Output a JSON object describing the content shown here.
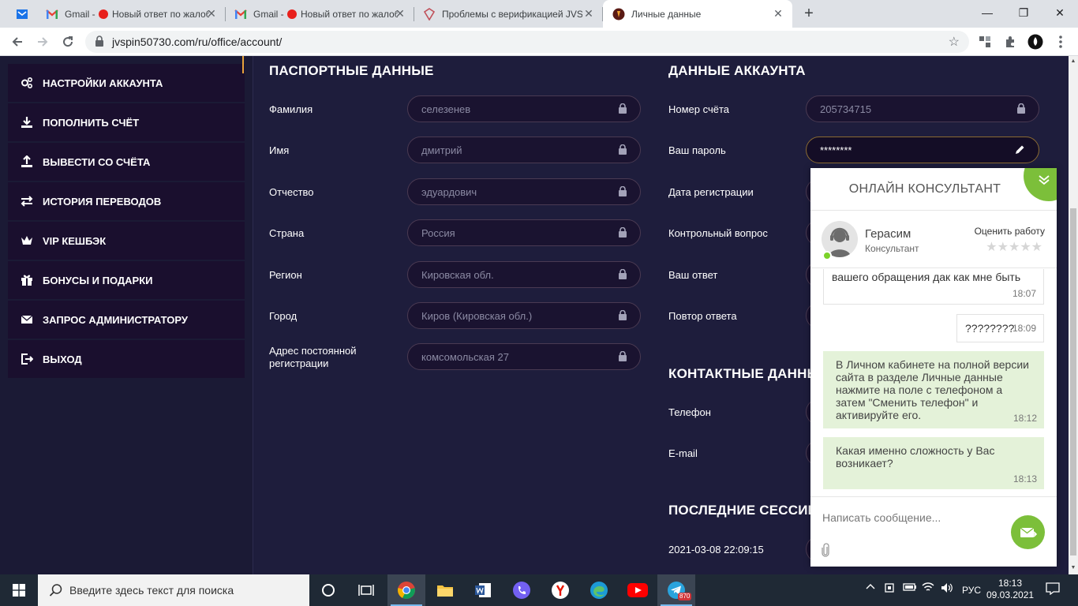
{
  "browser": {
    "tabs": [
      {
        "title": "Gmail - ",
        "rec_title": "Новый ответ по жалобе",
        "icon": "gmail-icon"
      },
      {
        "title": "Gmail - ",
        "rec_title": "Новый ответ по жалобе",
        "icon": "gmail-icon"
      },
      {
        "title": "Проблемы с верификацией JVSPIN",
        "icon": "complaint-site-icon"
      },
      {
        "title": "Личные данные",
        "icon": "jvspin-icon",
        "active": true
      }
    ],
    "url": "jvspin50730.com/ru/office/account/"
  },
  "sidebar": {
    "items": [
      {
        "label": "НАСТРОЙКИ АККАУНТА",
        "icon": "settings-gears-icon"
      },
      {
        "label": "ПОПОЛНИТЬ СЧЁТ",
        "icon": "download-icon"
      },
      {
        "label": "ВЫВЕСТИ СО СЧЁТА",
        "icon": "upload-icon"
      },
      {
        "label": "ИСТОРИЯ ПЕРЕВОДОВ",
        "icon": "transfer-arrows-icon"
      },
      {
        "label": "VIP КЕШБЭК",
        "icon": "crown-icon"
      },
      {
        "label": "БОНУСЫ И ПОДАРКИ",
        "icon": "gift-icon"
      },
      {
        "label": "ЗАПРОС АДМИНИСТРАТОРУ",
        "icon": "envelope-icon"
      },
      {
        "label": "ВЫХОД",
        "icon": "logout-icon"
      }
    ]
  },
  "passport": {
    "title": "ПАСПОРТНЫЕ ДАННЫЕ",
    "fields": [
      {
        "label": "Фамилия",
        "value": "селезенев"
      },
      {
        "label": "Имя",
        "value": "дмитрий"
      },
      {
        "label": "Отчество",
        "value": "эдуардович"
      },
      {
        "label": "Страна",
        "value": "Россия"
      },
      {
        "label": "Регион",
        "value": "Кировская обл."
      },
      {
        "label": "Город",
        "value": "Киров (Кировская обл.)"
      },
      {
        "label": "Адрес постоянной регистрации",
        "value": "комсомольская 27"
      }
    ]
  },
  "account": {
    "title": "ДАННЫЕ АККАУНТА",
    "fields": [
      {
        "label": "Номер счёта",
        "value": "205734715"
      },
      {
        "label": "Ваш пароль",
        "value": "********"
      },
      {
        "label": "Дата регистрации"
      },
      {
        "label": "Контрольный вопрос"
      },
      {
        "label": "Ваш ответ"
      },
      {
        "label": "Повтор ответа"
      }
    ]
  },
  "contacts": {
    "title": "КОНТАКТНЫЕ ДАННЫЕ",
    "fields": [
      {
        "label": "Телефон"
      },
      {
        "label": "E-mail"
      }
    ]
  },
  "sessions": {
    "title": "ПОСЛЕДНИЕ СЕССИИ",
    "rows": [
      {
        "datetime": "2021-03-08 22:09:15"
      }
    ]
  },
  "chat": {
    "title": "ОНЛАЙН КОНСУЛЬТАНТ",
    "agent_name": "Герасим",
    "agent_role": "Консультант",
    "rate_label": "Оценить работу",
    "rating": 0,
    "rating_max": 5,
    "messages": [
      {
        "dir": "in",
        "text": "вашего обращения дак как мне быть",
        "time": "18:07"
      },
      {
        "dir": "in",
        "text": "????????",
        "time": "18:09"
      },
      {
        "dir": "out",
        "text": "В Личном кабинете на полной версии сайта в разделе Личные данные нажмите на поле с телефоном а затем \"Сменить телефон\" и активируйте его.",
        "time": "18:12"
      },
      {
        "dir": "out",
        "text": "Какая именно сложность у Вас возникает?",
        "time": "18:13"
      }
    ],
    "input_placeholder": "Написать сообщение..."
  },
  "taskbar": {
    "search_placeholder": "Введите здесь текст для поиска",
    "telegram_badge": "870",
    "language": "РУС",
    "time": "18:13",
    "date": "09.03.2021"
  },
  "colors": {
    "page_bg": "#1b1a35",
    "accent_gold": "#e8a33c",
    "chat_green": "#7cbf3a"
  }
}
